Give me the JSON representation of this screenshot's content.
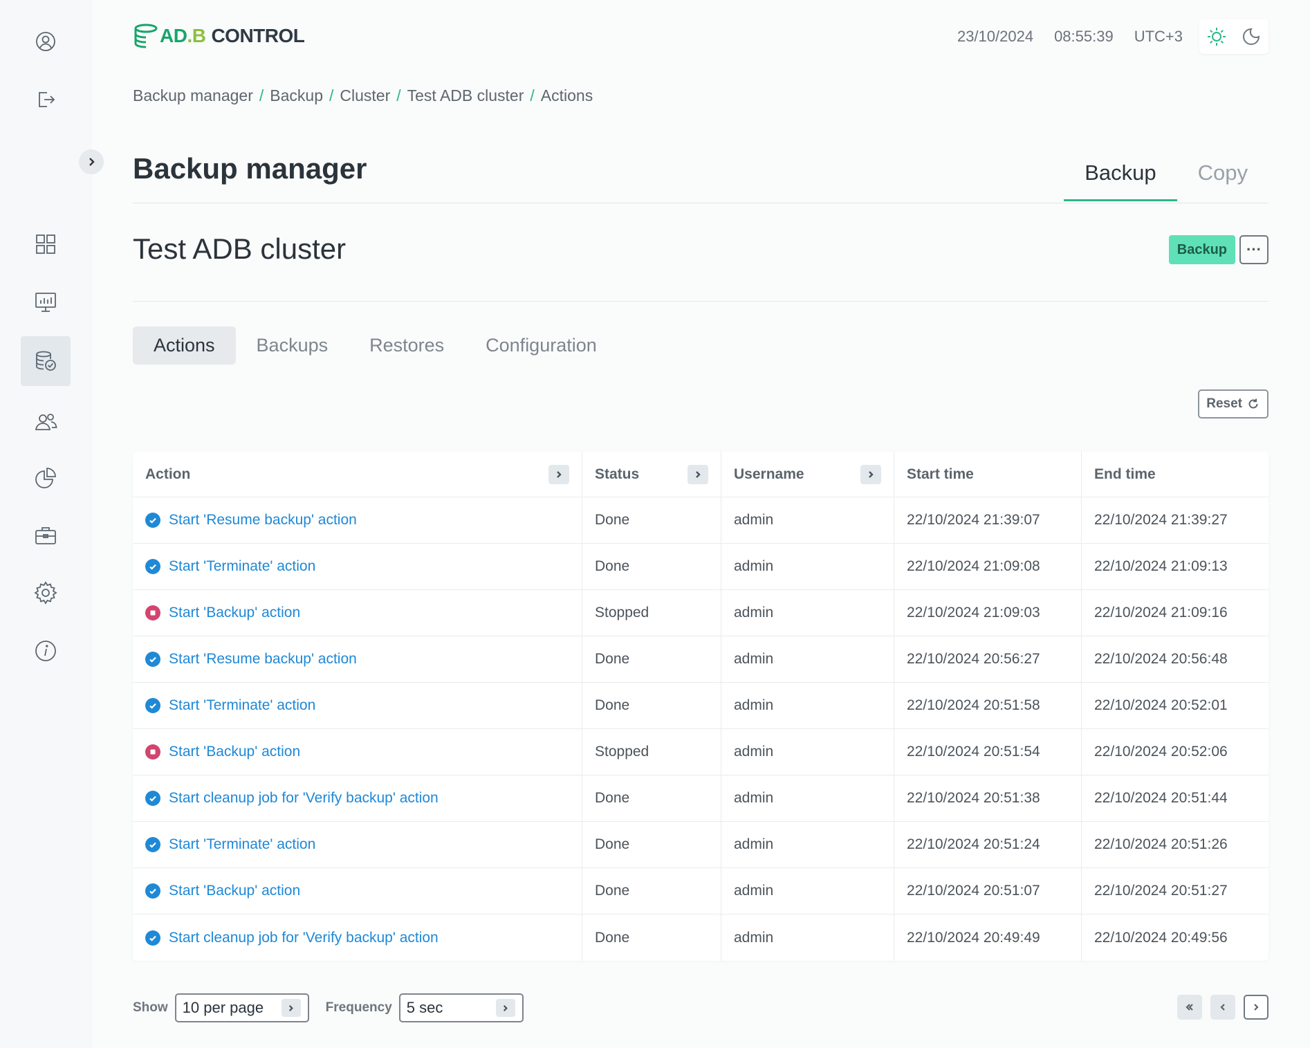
{
  "app": {
    "logo_part1": "AD",
    "logo_dot": ".B",
    "logo_part2": "CONTROL"
  },
  "header": {
    "date": "23/10/2024",
    "time": "08:55:39",
    "timezone": "UTC+3"
  },
  "sidebar": {
    "top_icons": [
      "user-profile-icon",
      "logout-icon"
    ],
    "items": [
      "dashboard-icon",
      "monitoring-icon",
      "backup-icon",
      "users-icon",
      "reports-icon",
      "toolbox-icon",
      "settings-icon",
      "info-icon"
    ],
    "active": "backup-icon"
  },
  "breadcrumb": [
    "Backup manager",
    "Backup",
    "Cluster",
    "Test ADB cluster",
    "Actions"
  ],
  "page": {
    "title": "Backup manager",
    "tabs": [
      "Backup",
      "Copy"
    ],
    "active_tab": "Backup"
  },
  "cluster": {
    "name": "Test ADB cluster",
    "badge": "Backup",
    "more": "···"
  },
  "subtabs": [
    "Actions",
    "Backups",
    "Restores",
    "Configuration"
  ],
  "reset_label": "Reset",
  "table": {
    "columns": [
      "Action",
      "Status",
      "Username",
      "Start time",
      "End time"
    ],
    "rows": [
      {
        "action": "Start 'Resume backup' action",
        "status": "Done",
        "user": "admin",
        "start": "22/10/2024 21:39:07",
        "end": "22/10/2024 21:39:27",
        "state": "done"
      },
      {
        "action": "Start 'Terminate' action",
        "status": "Done",
        "user": "admin",
        "start": "22/10/2024 21:09:08",
        "end": "22/10/2024 21:09:13",
        "state": "done"
      },
      {
        "action": "Start 'Backup' action",
        "status": "Stopped",
        "user": "admin",
        "start": "22/10/2024 21:09:03",
        "end": "22/10/2024 21:09:16",
        "state": "stopped"
      },
      {
        "action": "Start 'Resume backup' action",
        "status": "Done",
        "user": "admin",
        "start": "22/10/2024 20:56:27",
        "end": "22/10/2024 20:56:48",
        "state": "done"
      },
      {
        "action": "Start 'Terminate' action",
        "status": "Done",
        "user": "admin",
        "start": "22/10/2024 20:51:58",
        "end": "22/10/2024 20:52:01",
        "state": "done"
      },
      {
        "action": "Start 'Backup' action",
        "status": "Stopped",
        "user": "admin",
        "start": "22/10/2024 20:51:54",
        "end": "22/10/2024 20:52:06",
        "state": "stopped"
      },
      {
        "action": "Start cleanup job for 'Verify backup' action",
        "status": "Done",
        "user": "admin",
        "start": "22/10/2024 20:51:38",
        "end": "22/10/2024 20:51:44",
        "state": "done"
      },
      {
        "action": "Start 'Terminate' action",
        "status": "Done",
        "user": "admin",
        "start": "22/10/2024 20:51:24",
        "end": "22/10/2024 20:51:26",
        "state": "done"
      },
      {
        "action": "Start 'Backup' action",
        "status": "Done",
        "user": "admin",
        "start": "22/10/2024 20:51:07",
        "end": "22/10/2024 20:51:27",
        "state": "done"
      },
      {
        "action": "Start cleanup job for 'Verify backup' action",
        "status": "Done",
        "user": "admin",
        "start": "22/10/2024 20:49:49",
        "end": "22/10/2024 20:49:56",
        "state": "done"
      }
    ]
  },
  "footer": {
    "show_label": "Show",
    "per_page": "10 per page",
    "frequency_label": "Frequency",
    "frequency": "5 sec"
  },
  "colors": {
    "accent": "#2bb78a",
    "link": "#1e88d6",
    "done": "#1f89d6",
    "stopped": "#d1456f",
    "badge": "#5fe0b7"
  }
}
